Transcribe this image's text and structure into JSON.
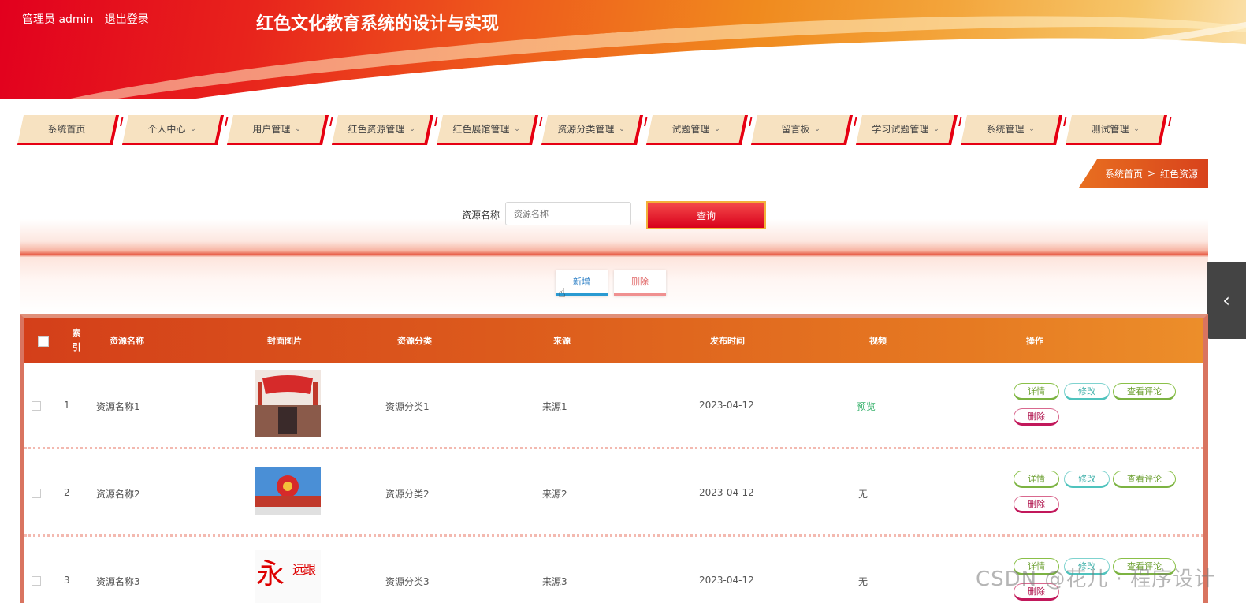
{
  "header": {
    "user_label": "管理员 admin",
    "logout_label": "退出登录",
    "site_title": "红色文化教育系统的设计与实现"
  },
  "nav": [
    {
      "label": "系统首页",
      "dropdown": false
    },
    {
      "label": "个人中心",
      "dropdown": true
    },
    {
      "label": "用户管理",
      "dropdown": true
    },
    {
      "label": "红色资源管理",
      "dropdown": true
    },
    {
      "label": "红色展馆管理",
      "dropdown": true
    },
    {
      "label": "资源分类管理",
      "dropdown": true
    },
    {
      "label": "试题管理",
      "dropdown": true
    },
    {
      "label": "留言板",
      "dropdown": true
    },
    {
      "label": "学习试题管理",
      "dropdown": true
    },
    {
      "label": "系统管理",
      "dropdown": true
    },
    {
      "label": "测试管理",
      "dropdown": true
    }
  ],
  "breadcrumb": {
    "home": "系统首页",
    "separator": ">",
    "current": "红色资源"
  },
  "search": {
    "label": "资源名称",
    "placeholder": "资源名称",
    "button_label": "查询"
  },
  "actions": {
    "add_label": "新增",
    "delete_label": "删除"
  },
  "table": {
    "headers": {
      "index_top": "索",
      "index_bottom": "引",
      "name": "资源名称",
      "cover": "封面图片",
      "category": "资源分类",
      "source": "来源",
      "publish_time": "发布时间",
      "video": "视频",
      "operations": "操作"
    },
    "rows": [
      {
        "index": "1",
        "name": "资源名称1",
        "category": "资源分类1",
        "source": "来源1",
        "date": "2023-04-12",
        "video": "预览",
        "video_is_link": true
      },
      {
        "index": "2",
        "name": "资源名称2",
        "category": "资源分类2",
        "source": "来源2",
        "date": "2023-04-12",
        "video": "无",
        "video_is_link": false
      },
      {
        "index": "3",
        "name": "资源名称3",
        "category": "资源分类3",
        "source": "来源3",
        "date": "2023-04-12",
        "video": "无",
        "video_is_link": false
      }
    ],
    "op_labels": {
      "detail": "详情",
      "edit": "修改",
      "comments": "查看评论",
      "delete": "删除"
    }
  },
  "watermark": "CSDN @花儿 · 程序设计",
  "icons": {
    "chevron": "chevron-down-icon",
    "side_toggle": "chevron-left-icon",
    "cursor": "hand-cursor-icon"
  },
  "colors": {
    "brand_red": "#e60012",
    "nav_bg": "#f7e2c1",
    "table_header_start": "#d43f1a",
    "table_header_end": "#ec8e2a"
  }
}
